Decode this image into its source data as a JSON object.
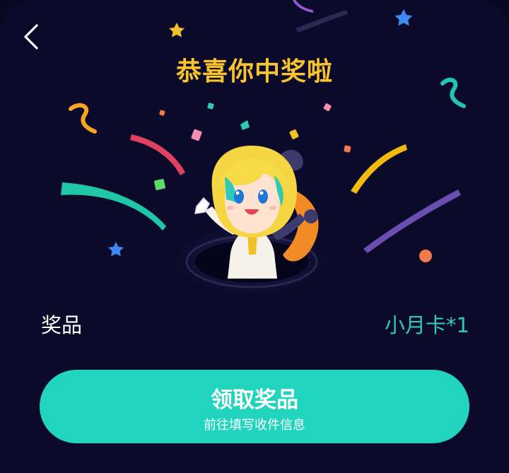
{
  "header": {
    "back_icon": "chevron-left-icon",
    "title": "恭喜你中奖啦"
  },
  "prize": {
    "label": "奖品",
    "value": "小月卡*1"
  },
  "claim_button": {
    "title": "领取奖品",
    "subtitle": "前往填写收件信息"
  },
  "colors": {
    "background": "#0c0a2a",
    "title": "#f7c42e",
    "accent": "#21d4be",
    "prize_value": "#2ec9b7"
  },
  "decorations": {
    "mascot": "cartoon-mascot-in-hole",
    "confetti": "celebration-confetti"
  }
}
